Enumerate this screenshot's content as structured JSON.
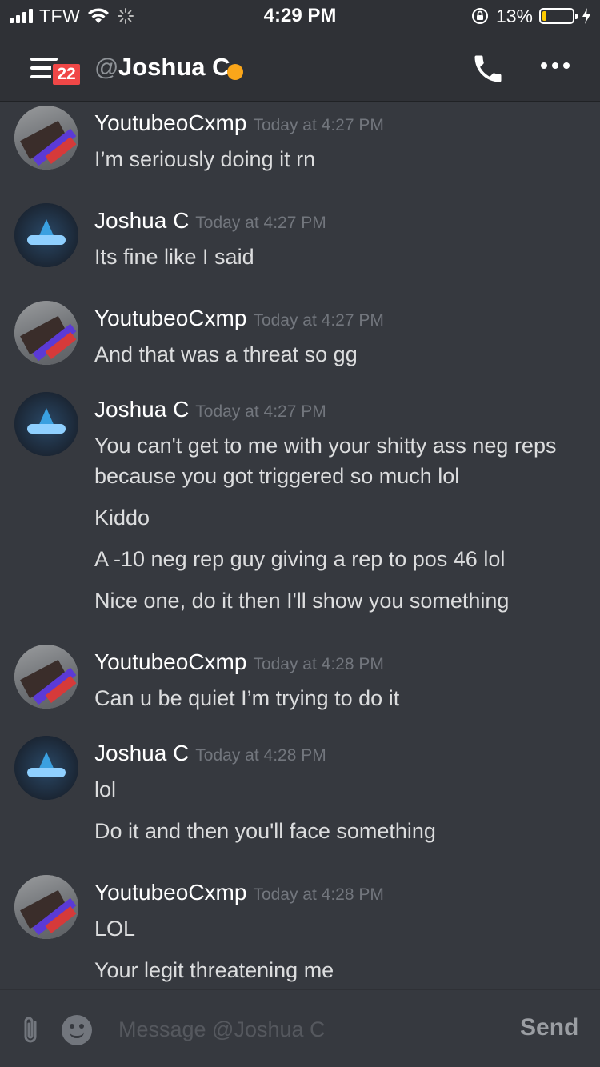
{
  "status_bar": {
    "carrier": "TFW",
    "time": "4:29 PM",
    "battery_percent": "13%",
    "battery_level": 0.13,
    "icons": [
      "signal-bars-icon",
      "wifi-icon",
      "loading-spinner-icon",
      "orientation-lock-icon",
      "battery-icon",
      "charging-bolt-icon"
    ]
  },
  "header": {
    "menu_icon": "hamburger-menu-icon",
    "unread_badge": "22",
    "at_symbol": "@",
    "channel_name": "Joshua C",
    "status_color": "#faa61a",
    "call_icon": "phone-icon",
    "more_icon": "more-dots-icon"
  },
  "messages": [
    {
      "author": "YoutubeoCxmp",
      "timestamp": "Today at 4:27 PM",
      "avatar": "avatar-youtubeocxmp",
      "lines": [
        "I’m seriously doing it rn"
      ]
    },
    {
      "author": "Joshua C",
      "timestamp": "Today at 4:27 PM",
      "avatar": "avatar-joshua",
      "lines": [
        "Its fine like I said"
      ]
    },
    {
      "author": "YoutubeoCxmp",
      "timestamp": "Today at 4:27 PM",
      "avatar": "avatar-youtubeocxmp",
      "lines": [
        "And that was a threat so gg"
      ]
    },
    {
      "author": "Joshua C",
      "timestamp": "Today at 4:27 PM",
      "avatar": "avatar-joshua",
      "lines": [
        "You can't get to me with your shitty ass neg reps because you got triggered so much lol",
        "Kiddo",
        "A -10 neg rep guy giving a rep to pos 46 lol",
        "Nice one, do it then I'll show you something"
      ]
    },
    {
      "author": "YoutubeoCxmp",
      "timestamp": "Today at 4:28 PM",
      "avatar": "avatar-youtubeocxmp",
      "lines": [
        "Can u be quiet I’m trying to do it"
      ]
    },
    {
      "author": "Joshua C",
      "timestamp": "Today at 4:28 PM",
      "avatar": "avatar-joshua",
      "lines": [
        "lol",
        "Do it and then you'll face something"
      ]
    },
    {
      "author": "YoutubeoCxmp",
      "timestamp": "Today at 4:28 PM",
      "avatar": "avatar-youtubeocxmp",
      "lines": [
        "LOL",
        "Your legit threatening me"
      ]
    }
  ],
  "input_bar": {
    "attach_icon": "paperclip-icon",
    "emoji_icon": "emoji-icon",
    "placeholder": "Message @Joshua C",
    "value": "",
    "send_label": "Send"
  }
}
